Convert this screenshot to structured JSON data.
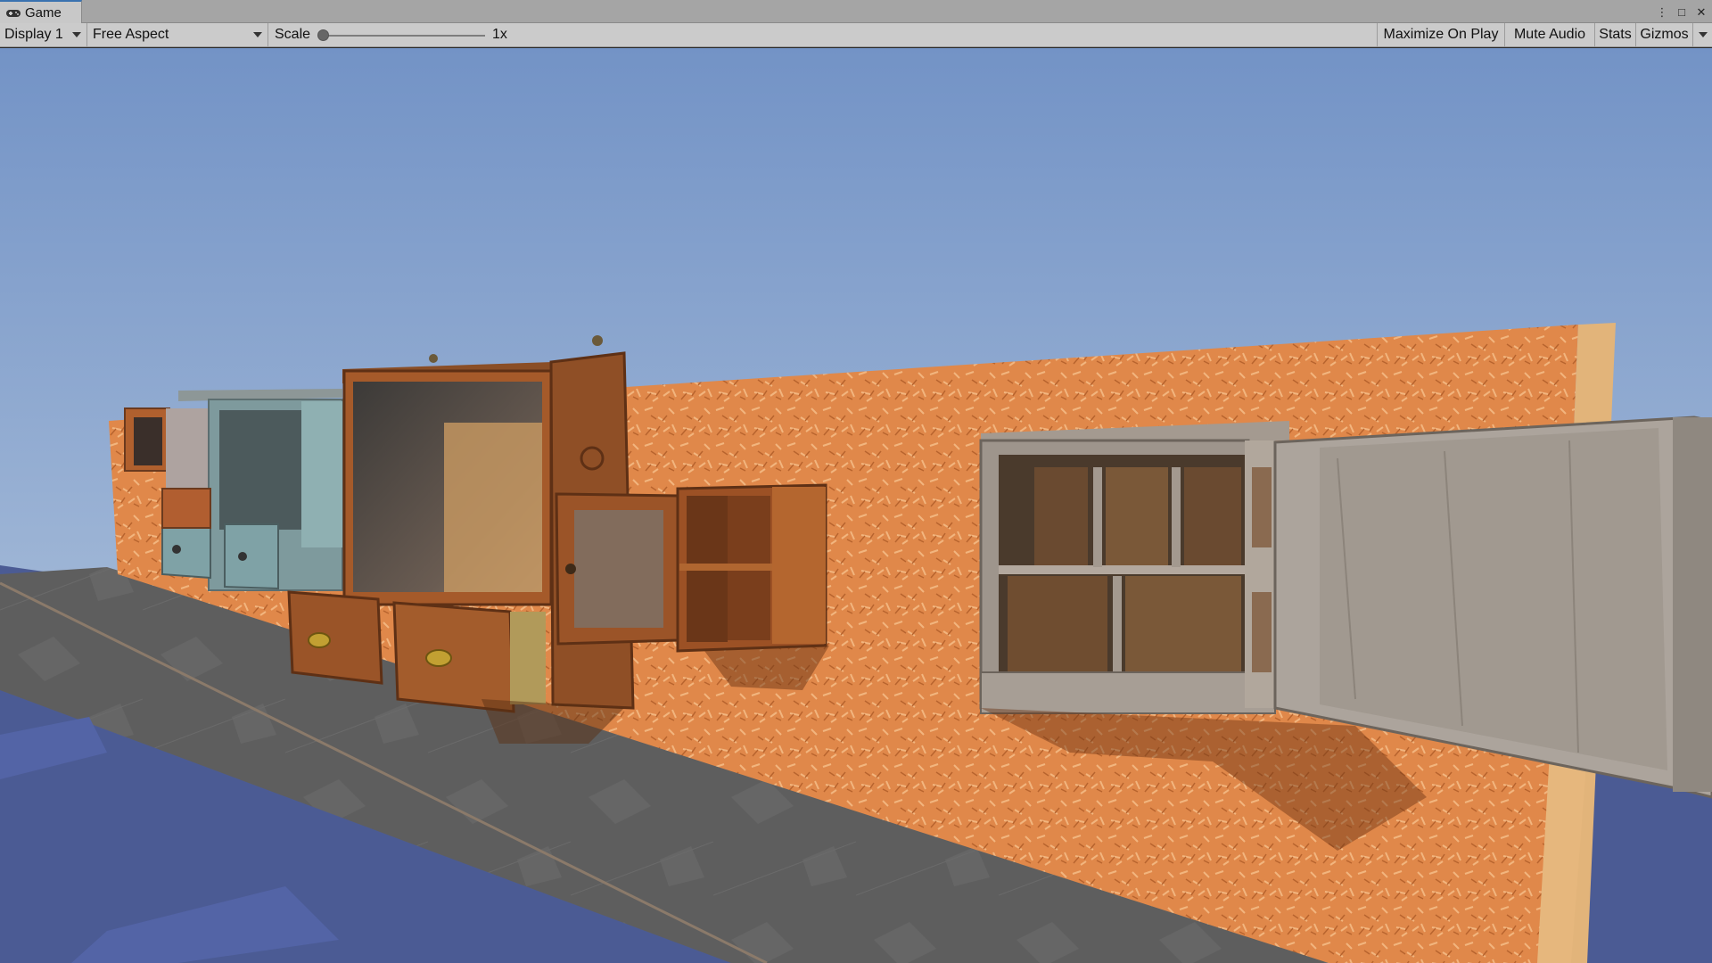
{
  "tab": {
    "title": "Game",
    "icon": "gamepad-icon"
  },
  "window_controls": {
    "more": "⋮",
    "maximize": "□",
    "close": "✕"
  },
  "toolbar": {
    "display": "Display 1",
    "aspect": "Free Aspect",
    "scale_label": "Scale",
    "scale_value": "1x",
    "scale_slider_level": 0,
    "maximize_on_play": "Maximize On Play",
    "mute_audio": "Mute Audio",
    "stats": "Stats",
    "gizmos": "Gizmos"
  },
  "scene": {
    "description_icon": "3d-scene",
    "colors": {
      "sky_top": "#7393c6",
      "sky_horizon": "#dbe6f0",
      "wall": "#e0884a",
      "floor": "#5c5c5c",
      "water": "#4b5b94"
    }
  }
}
